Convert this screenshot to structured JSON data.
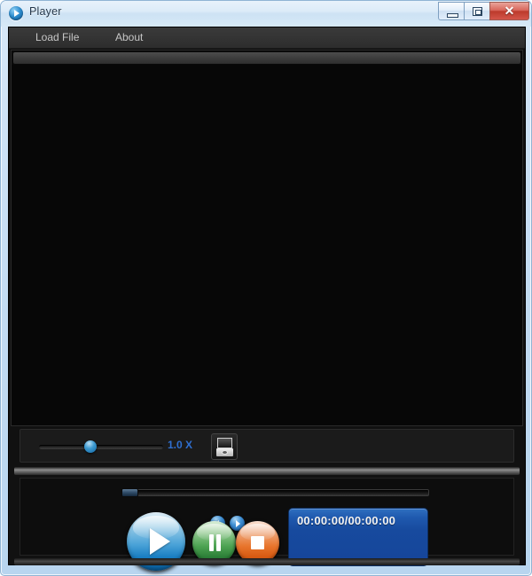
{
  "window": {
    "title": "Player",
    "icon": "play-circle-icon",
    "controls": {
      "minimize": "minimize-icon",
      "maximize": "maximize-icon",
      "close": "✕"
    }
  },
  "menubar": {
    "items": [
      {
        "label": "Load File",
        "name": "menu-item-load-file"
      },
      {
        "label": "About",
        "name": "menu-item-about"
      }
    ]
  },
  "video": {
    "content": ""
  },
  "speed_bar": {
    "slider_value": 1.0,
    "slider_min": 0.0,
    "slider_max": 2.0,
    "slider_percent": 36,
    "speed_label": "1.0 X",
    "speed_label_color": "#2f6fd0",
    "snapshot_button": "camera-icon"
  },
  "transport": {
    "seek_percent": 0,
    "prev_button": "previous-arrow-icon",
    "next_button": "next-arrow-icon",
    "play_button": "play-icon",
    "pause_button": "pause-icon",
    "stop_button": "stop-icon",
    "play_color": "#1278be",
    "pause_color": "#4da352",
    "stop_color": "#e8752c"
  },
  "time_display": {
    "text": "00:00:00/00:00:00",
    "current": "00:00:00",
    "total": "00:00:00",
    "background_color": "#1a52a6"
  }
}
